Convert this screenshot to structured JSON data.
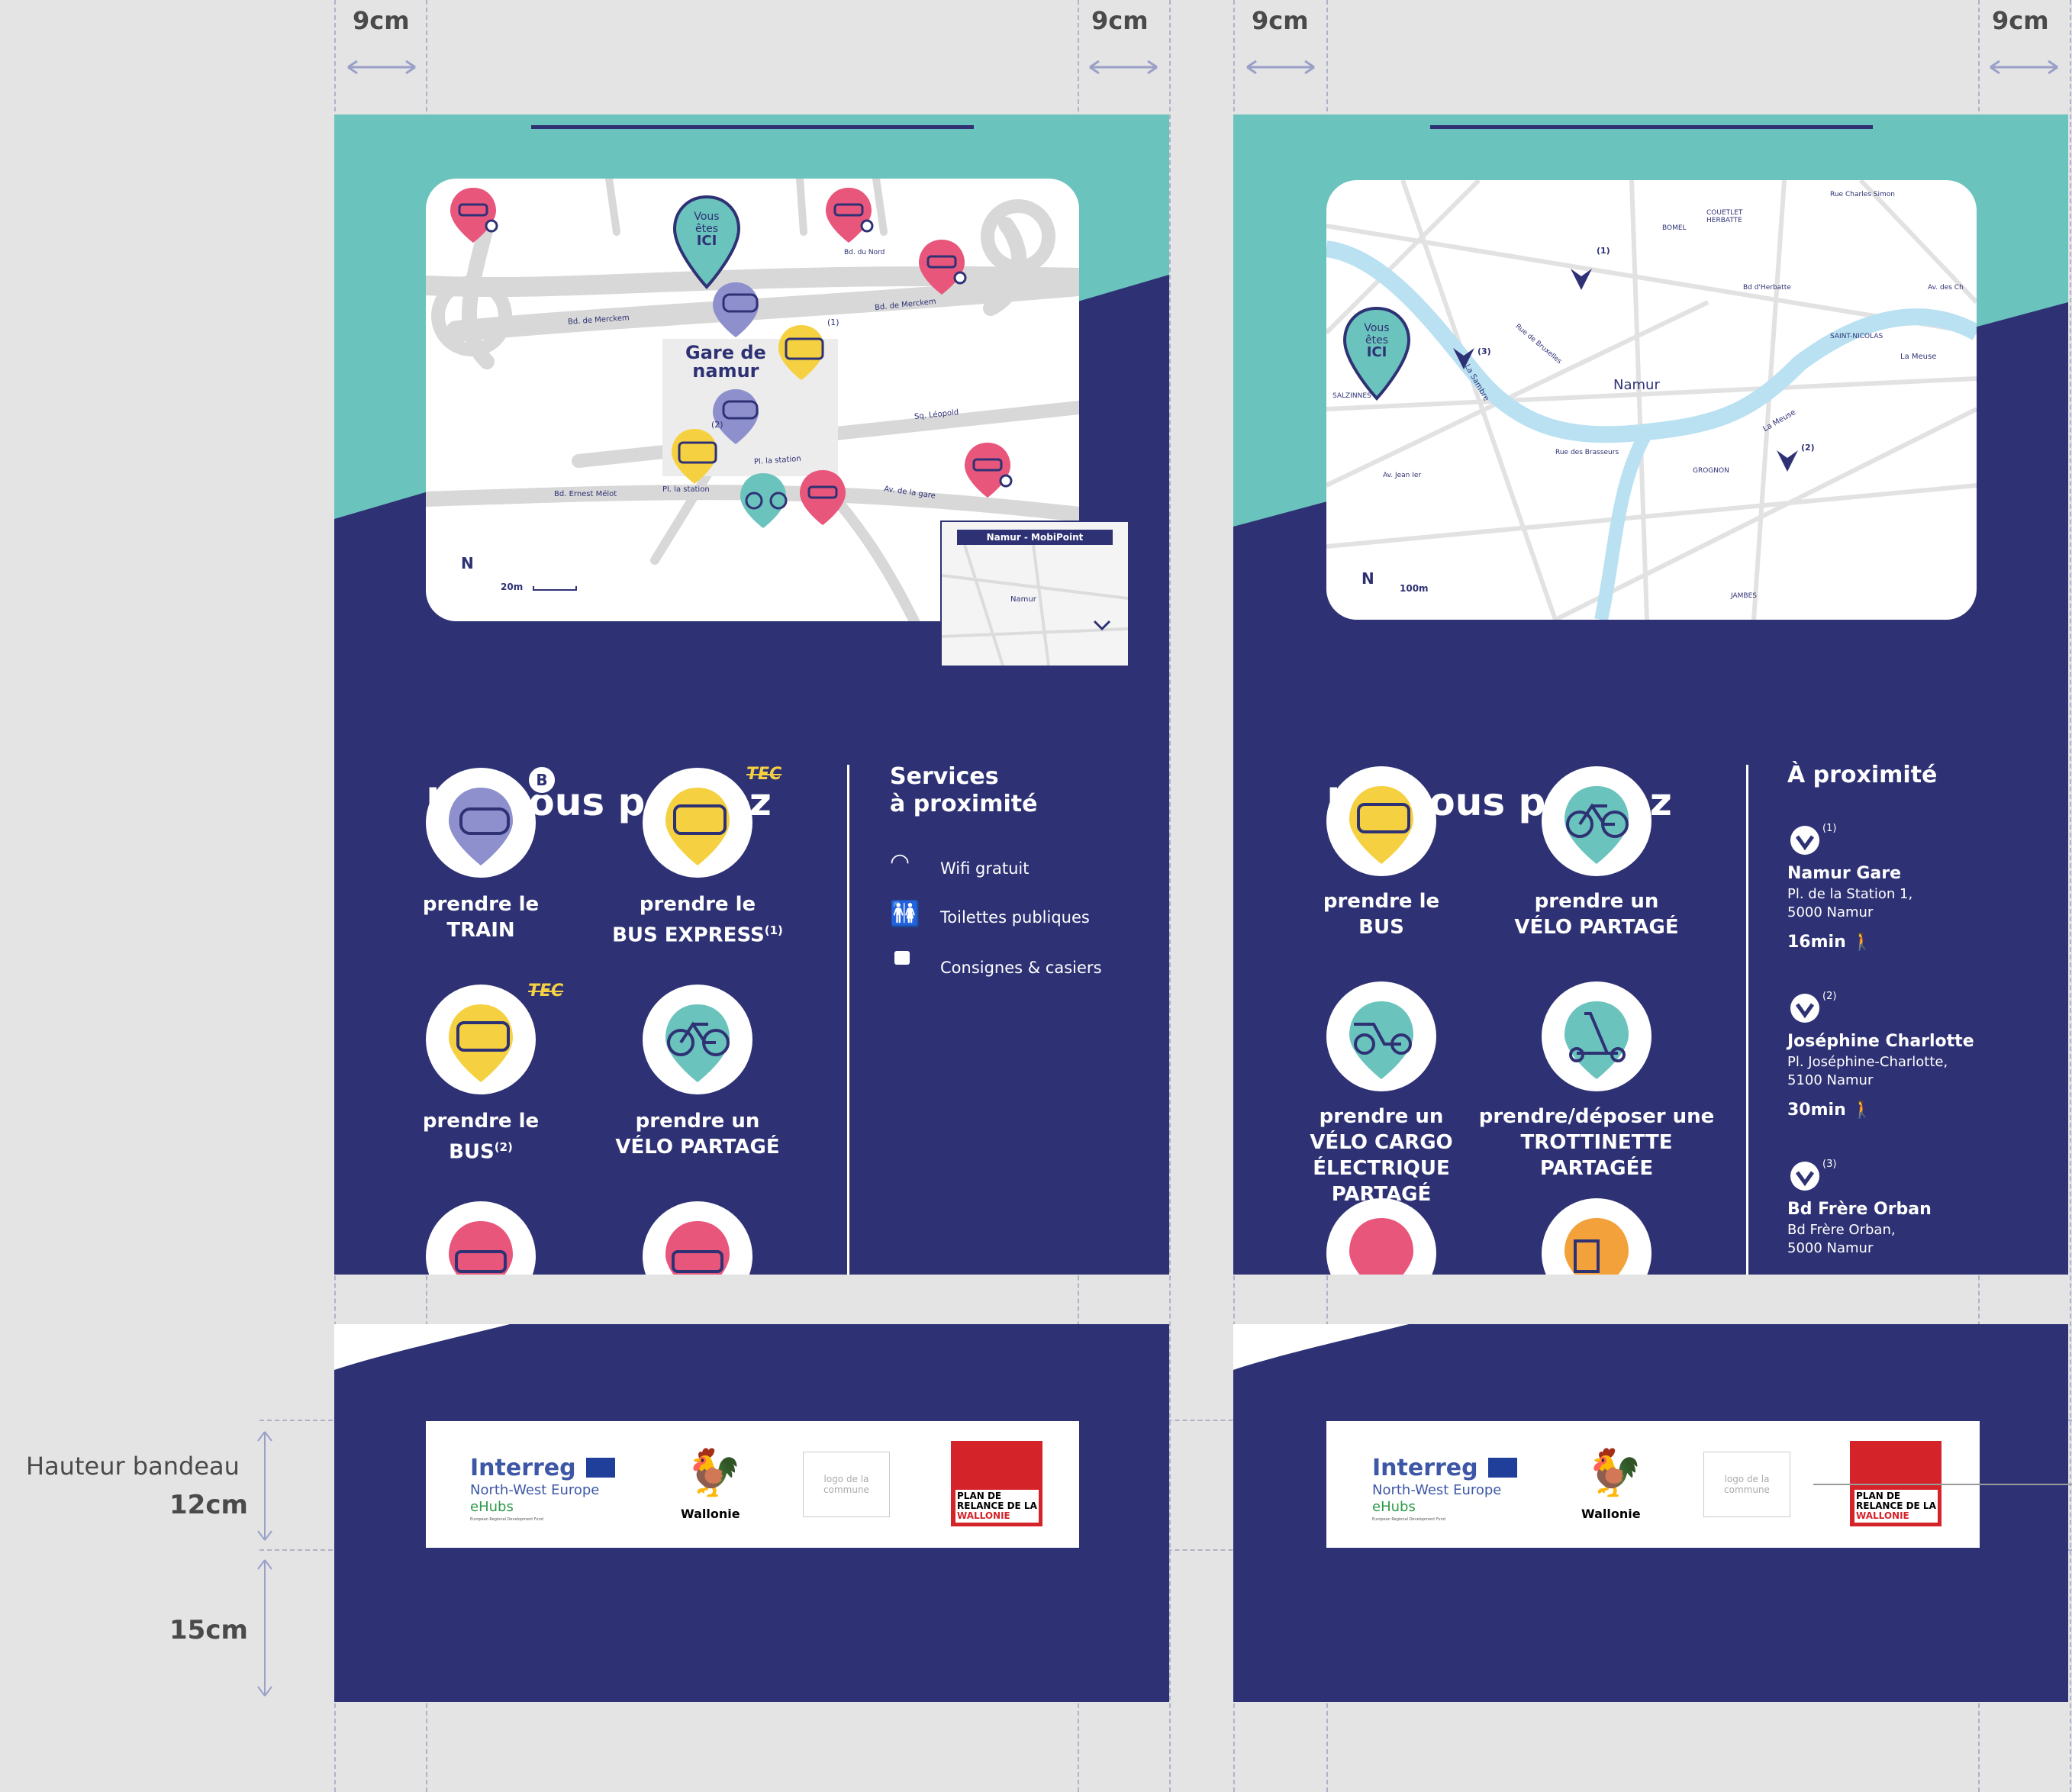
{
  "dimensions": {
    "margin_label": "9cm",
    "band_height_label": "Hauteur bandeau",
    "band_height_value": "12cm",
    "bottom_value": "15cm"
  },
  "panel1": {
    "map": {
      "you_are_here": [
        "Vous",
        "êtes",
        "ICI"
      ],
      "station_label": [
        "Gare de",
        "namur"
      ],
      "streets": [
        "Bd. de Merckem",
        "Bd. de Merckem",
        "Sq. Léopold",
        "Pl. la station",
        "Pl. la station",
        "Bd. Ernest Mélot",
        "Av. de la gare",
        "Bd. du Nord"
      ],
      "bus_refs": [
        "(1)",
        "(2)"
      ],
      "north": "N",
      "scale": "20m",
      "inset_title": "Namur - MobiPoint",
      "inset_city": "Namur"
    },
    "title": "Ici, vous pouvez",
    "services": [
      {
        "line1": "prendre le",
        "line2": "TRAIN",
        "sup": ""
      },
      {
        "line1": "prendre le",
        "line2": "BUS EXPRESS",
        "sup": "(1)"
      },
      {
        "line1": "prendre le",
        "line2": "BUS",
        "sup": "(2)"
      },
      {
        "line1": "prendre un",
        "line2": "VÉLO PARTAGÉ",
        "sup": ""
      }
    ],
    "badges": {
      "sncb": "B",
      "tec1": "TEC",
      "tec2": "TEC"
    },
    "side_title": [
      "Services",
      "à proximité"
    ],
    "side_items": [
      "Wifi gratuit",
      "Toilettes publiques",
      "Consignes & casiers"
    ]
  },
  "panel2": {
    "map": {
      "you_are_here": [
        "Vous",
        "êtes",
        "ICI"
      ],
      "city": "Namur",
      "refs": [
        "(1)",
        "(2)",
        "(3)"
      ],
      "north": "N",
      "scale": "100m",
      "labels": [
        "BOMEL",
        "COUETLET HERBATTE",
        "SAINT-NICOLAS",
        "SALZINNES",
        "GROGNON",
        "JAMBES",
        "La Meuse",
        "La Meuse",
        "La Sambre",
        "Bd d'Herbatte",
        "Rue de Bruxelles",
        "Rue des Brasseurs",
        "Av. Jean Ier",
        "Rue Charles Simon",
        "Av. des Ch"
      ]
    },
    "title": "Ici, vous pouvez",
    "services": [
      {
        "lines": [
          "prendre le",
          "BUS"
        ]
      },
      {
        "lines": [
          "prendre un",
          "VÉLO PARTAGÉ"
        ]
      },
      {
        "lines": [
          "prendre un",
          "VÉLO CARGO",
          "ÉLECTRIQUE PARTAGÉ"
        ]
      },
      {
        "lines": [
          "prendre/déposer une",
          "TROTTINETTE",
          "PARTAGÉE"
        ]
      }
    ],
    "side_title": "À proximité",
    "nearby": [
      {
        "ref": "(1)",
        "name": "Namur Gare",
        "addr1": "Pl. de la Station 1,",
        "addr2": "5000 Namur",
        "time": "16min"
      },
      {
        "ref": "(2)",
        "name": "Joséphine Charlotte",
        "addr1": "Pl. Joséphine-Charlotte,",
        "addr2": "5100 Namur",
        "time": "30min"
      },
      {
        "ref": "(3)",
        "name": "Bd Frère Orban",
        "addr1": "Bd Frère Orban,",
        "addr2": "5000 Namur",
        "time": ""
      }
    ]
  },
  "logos": {
    "interreg": "Interreg",
    "nwe": "North-West Europe",
    "ehubs": "eHubs",
    "erdf": "European Regional Development Fund",
    "wallonie": "Wallonie",
    "commune": [
      "logo de la",
      "commune"
    ],
    "plan": [
      "PLAN DE",
      "RELANCE DE LA",
      "WALLONIE"
    ]
  },
  "colors": {
    "navy": "#2e3274",
    "teal": "#6bc3bd",
    "pink": "#e8567b",
    "yellow": "#f5d142",
    "lavender": "#8d90cd",
    "orange": "#f3a23b"
  }
}
